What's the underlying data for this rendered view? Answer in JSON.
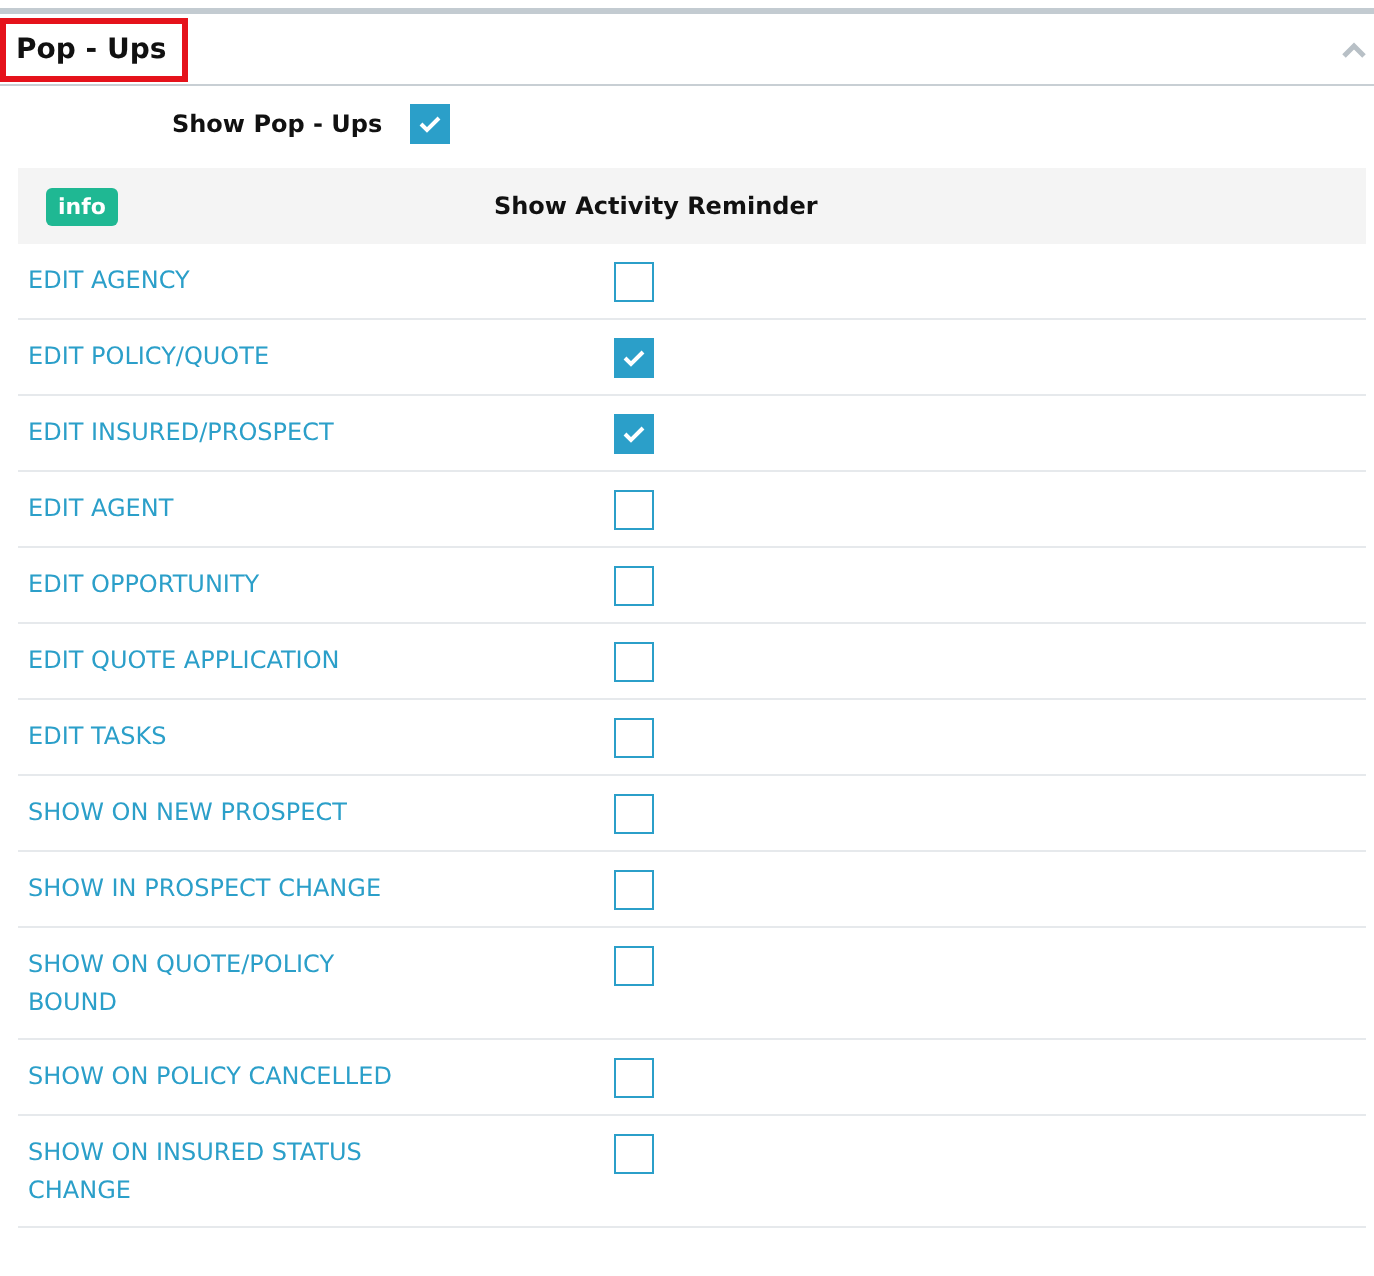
{
  "panel": {
    "title": "Pop - Ups",
    "expanded": true
  },
  "show_popups": {
    "label": "Show Pop - Ups",
    "checked": true
  },
  "header": {
    "badge": "info",
    "label": "Show Activity Reminder"
  },
  "rows": [
    {
      "label": "EDIT AGENCY",
      "checked": false
    },
    {
      "label": "EDIT POLICY/QUOTE",
      "checked": true
    },
    {
      "label": "EDIT INSURED/PROSPECT",
      "checked": true
    },
    {
      "label": "EDIT AGENT",
      "checked": false
    },
    {
      "label": "EDIT OPPORTUNITY",
      "checked": false
    },
    {
      "label": "EDIT QUOTE APPLICATION",
      "checked": false
    },
    {
      "label": "EDIT TASKS",
      "checked": false
    },
    {
      "label": "SHOW ON NEW PROSPECT",
      "checked": false
    },
    {
      "label": "SHOW IN PROSPECT CHANGE",
      "checked": false
    },
    {
      "label": "SHOW ON QUOTE/POLICY BOUND",
      "checked": false
    },
    {
      "label": "SHOW ON POLICY CANCELLED",
      "checked": false
    },
    {
      "label": "SHOW ON INSURED STATUS CHANGE",
      "checked": false
    }
  ]
}
